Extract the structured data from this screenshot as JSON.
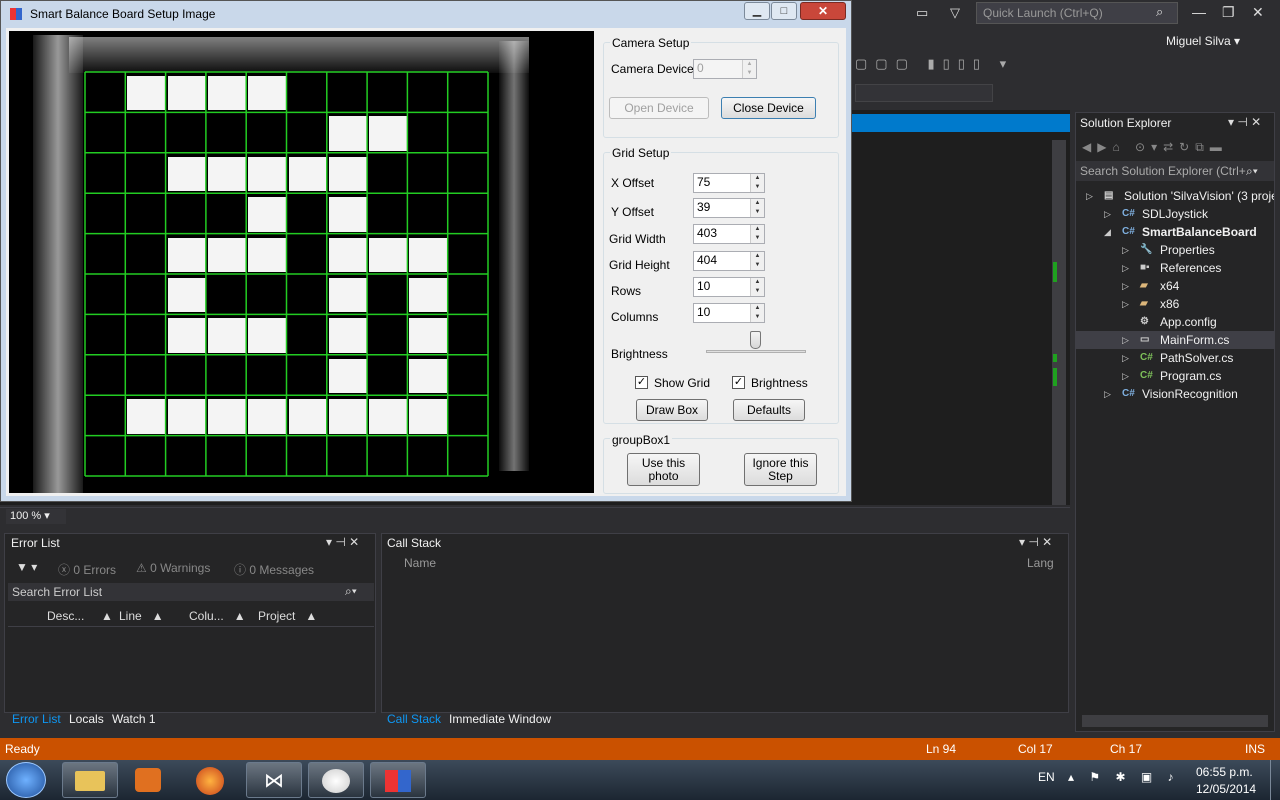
{
  "vs": {
    "quick_launch_placeholder": "Quick Launch (Ctrl+Q)",
    "user": "Miguel Silva",
    "zoom": "100 %"
  },
  "dialog": {
    "title": "Smart Balance Board Setup Image",
    "camera_setup": {
      "group_label": "Camera Setup",
      "device_label": "Camera Device",
      "device_value": "0",
      "open_device": "Open Device",
      "close_device": "Close Device"
    },
    "grid_setup": {
      "group_label": "Grid Setup",
      "fields": [
        {
          "label": "X Offset",
          "value": "75"
        },
        {
          "label": "Y Offset",
          "value": "39"
        },
        {
          "label": "Grid Width",
          "value": "403"
        },
        {
          "label": "Grid Height",
          "value": "404"
        },
        {
          "label": "Rows",
          "value": "10"
        },
        {
          "label": "Columns",
          "value": "10"
        }
      ],
      "brightness_label": "Brightness",
      "brightness_level": 0.5,
      "show_grid_label": "Show Grid",
      "show_grid_checked": true,
      "brightness_check_label": "Brightness",
      "brightness_checked": true,
      "draw_box": "Draw Box",
      "defaults": "Defaults"
    },
    "group_box1": {
      "label": "groupBox1",
      "use_photo": "Use this photo",
      "ignore_step": "Ignore this Step"
    },
    "grid_cells": [
      [
        0,
        1,
        1,
        1,
        1,
        0,
        0,
        0,
        0,
        0
      ],
      [
        0,
        0,
        0,
        0,
        0,
        0,
        1,
        1,
        0,
        0
      ],
      [
        0,
        0,
        1,
        1,
        1,
        1,
        1,
        0,
        0,
        0
      ],
      [
        0,
        0,
        0,
        0,
        1,
        0,
        1,
        0,
        0,
        0
      ],
      [
        0,
        0,
        1,
        1,
        1,
        0,
        1,
        1,
        1,
        0
      ],
      [
        0,
        0,
        1,
        0,
        0,
        0,
        1,
        0,
        1,
        0
      ],
      [
        0,
        0,
        1,
        1,
        1,
        0,
        1,
        0,
        1,
        0
      ],
      [
        0,
        0,
        0,
        0,
        0,
        0,
        1,
        0,
        1,
        0
      ],
      [
        0,
        1,
        1,
        1,
        1,
        1,
        1,
        1,
        1,
        0
      ],
      [
        0,
        0,
        0,
        0,
        0,
        0,
        0,
        0,
        0,
        0
      ]
    ]
  },
  "error_list": {
    "title": "Error List",
    "errors": "0 Errors",
    "warnings": "0 Warnings",
    "messages": "0 Messages",
    "search_placeholder": "Search Error List",
    "columns": [
      "Desc...",
      "Line",
      "Colu...",
      "Project"
    ],
    "tabs": [
      "Error List",
      "Locals",
      "Watch 1"
    ]
  },
  "call_stack": {
    "title": "Call Stack",
    "columns": [
      "Name",
      "Lang"
    ],
    "tabs": [
      "Call Stack",
      "Immediate Window"
    ]
  },
  "solution_explorer": {
    "title": "Solution Explorer",
    "search_placeholder": "Search Solution Explorer (Ctrl+",
    "items": [
      {
        "label": "Solution 'SilvaVision' (3 projects)",
        "icon": "solution-icon",
        "indent": 0
      },
      {
        "label": "SDLJoystick",
        "icon": "csharp-project-icon",
        "indent": 1
      },
      {
        "label": "SmartBalanceBoard",
        "icon": "csharp-project-icon",
        "indent": 1,
        "bold": true
      },
      {
        "label": "Properties",
        "icon": "wrench-icon",
        "indent": 2
      },
      {
        "label": "References",
        "icon": "references-icon",
        "indent": 2
      },
      {
        "label": "x64",
        "icon": "folder-icon",
        "indent": 2
      },
      {
        "label": "x86",
        "icon": "folder-icon",
        "indent": 2
      },
      {
        "label": "App.config",
        "icon": "config-icon",
        "indent": 2
      },
      {
        "label": "MainForm.cs",
        "icon": "form-icon",
        "indent": 2,
        "selected": true
      },
      {
        "label": "PathSolver.cs",
        "icon": "csharp-file-icon",
        "indent": 2
      },
      {
        "label": "Program.cs",
        "icon": "csharp-file-icon",
        "indent": 2
      },
      {
        "label": "VisionRecognition",
        "icon": "csharp-project-icon",
        "indent": 1
      }
    ]
  },
  "status_bar": {
    "ready": "Ready",
    "ln": "Ln 94",
    "col": "Col 17",
    "ch": "Ch 17",
    "ins": "INS"
  },
  "taskbar": {
    "lang": "EN",
    "time": "06:55 p.m.",
    "date": "12/05/2014"
  },
  "colors": {
    "status_bar": "#ca5100",
    "grid_line": "#22cc22",
    "accent": "#007acc"
  }
}
